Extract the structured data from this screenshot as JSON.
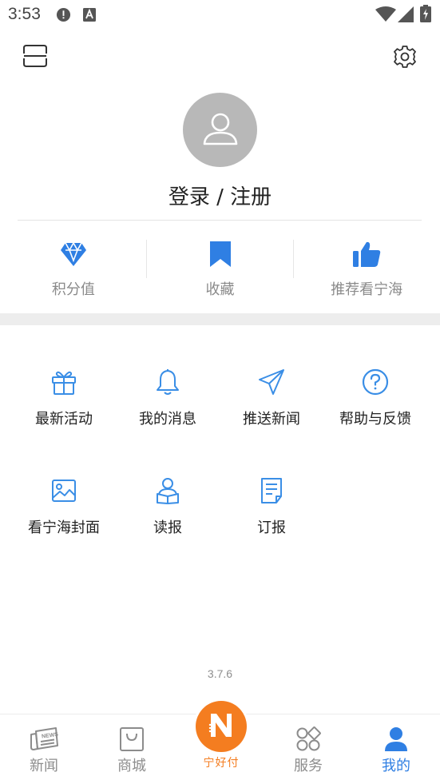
{
  "status_bar": {
    "time": "3:53",
    "icons": [
      "alert-circle-icon",
      "a-text-icon",
      "wifi-icon",
      "signal-icon",
      "battery-charging-icon"
    ]
  },
  "header": {
    "menu_icon": "scan-frame-icon",
    "settings_icon": "gear-icon"
  },
  "profile": {
    "avatar_icon": "user-icon",
    "login_label": "登录 / 注册"
  },
  "stats": [
    {
      "icon": "diamond-icon",
      "label": "积分值"
    },
    {
      "icon": "bookmark-icon",
      "label": "收藏"
    },
    {
      "icon": "thumbs-up-icon",
      "label": "推荐看宁海"
    }
  ],
  "menu": [
    {
      "icon": "gift-icon",
      "label": "最新活动"
    },
    {
      "icon": "bell-icon",
      "label": "我的消息"
    },
    {
      "icon": "paper-plane-icon",
      "label": "推送新闻"
    },
    {
      "icon": "question-icon",
      "label": "帮助与反馈"
    },
    {
      "icon": "image-icon",
      "label": "看宁海封面"
    },
    {
      "icon": "reader-icon",
      "label": "读报"
    },
    {
      "icon": "document-icon",
      "label": "订报"
    }
  ],
  "version": "3.7.6",
  "tabs": [
    {
      "icon": "newspaper-icon",
      "label": "新闻"
    },
    {
      "icon": "shopping-bag-icon",
      "label": "商城"
    },
    {
      "icon": "pay-n-icon",
      "label": "宁好付"
    },
    {
      "icon": "grid-services-icon",
      "label": "服务"
    },
    {
      "icon": "person-icon",
      "label": "我的"
    }
  ],
  "colors": {
    "accent_blue": "#2f7fe3",
    "icon_blue": "#3a8ee6",
    "pay_orange": "#f47d20",
    "avatar_gray": "#b8b8b8",
    "inactive_gray": "#8c8c8c"
  }
}
